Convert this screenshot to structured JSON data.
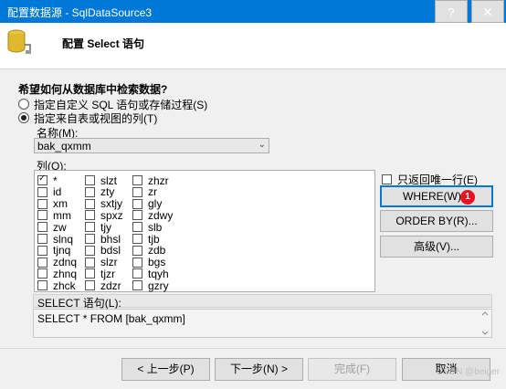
{
  "window": {
    "title": "配置数据源 - SqlDataSource3",
    "help_label": "?",
    "close_label": "✕"
  },
  "header": {
    "heading": "配置 Select 语句",
    "icon": "database-icon"
  },
  "prompt": "希望如何从数据库中检索数据?",
  "options": {
    "custom_sql": "指定自定义 SQL 语句或存储过程(S)",
    "table_cols": "指定来自表或视图的列(T)"
  },
  "name_label": "名称(M):",
  "table_select": {
    "value": "bak_qxmm"
  },
  "columns_label": "列(O):",
  "columns": {
    "c1": [
      {
        "name": "*",
        "checked": true
      },
      {
        "name": "id",
        "checked": false
      },
      {
        "name": "xm",
        "checked": false
      },
      {
        "name": "mm",
        "checked": false
      },
      {
        "name": "zw",
        "checked": false
      },
      {
        "name": "slnq",
        "checked": false
      },
      {
        "name": "tjnq",
        "checked": false
      },
      {
        "name": "zdnq",
        "checked": false
      },
      {
        "name": "zhnq",
        "checked": false
      },
      {
        "name": "zhck",
        "checked": false
      }
    ],
    "c2": [
      {
        "name": "slzt",
        "checked": false
      },
      {
        "name": "zty",
        "checked": false
      },
      {
        "name": "sxtjy",
        "checked": false
      },
      {
        "name": "spxz",
        "checked": false
      },
      {
        "name": "tjy",
        "checked": false
      },
      {
        "name": "bhsl",
        "checked": false
      },
      {
        "name": "bdsl",
        "checked": false
      },
      {
        "name": "slzr",
        "checked": false
      },
      {
        "name": "tjzr",
        "checked": false
      },
      {
        "name": "zdzr",
        "checked": false
      }
    ],
    "c3": [
      {
        "name": "zhzr",
        "checked": false
      },
      {
        "name": "zr",
        "checked": false
      },
      {
        "name": "gly",
        "checked": false
      },
      {
        "name": "zdwy",
        "checked": false
      },
      {
        "name": "slb",
        "checked": false
      },
      {
        "name": "tjb",
        "checked": false
      },
      {
        "name": "zdb",
        "checked": false
      },
      {
        "name": "bgs",
        "checked": false
      },
      {
        "name": "tqyh",
        "checked": false
      },
      {
        "name": "gzry",
        "checked": false
      }
    ]
  },
  "unique_rows_label": "只返回唯一行(E)",
  "buttons": {
    "where": "WHERE(W)...",
    "order_by": "ORDER BY(R)...",
    "advanced": "高级(V)...",
    "prev": "< 上一步(P)",
    "next": "下一步(N) >",
    "finish": "完成(F)",
    "cancel": "取消"
  },
  "badge": "1",
  "sql": {
    "label": "SELECT 语句(L):",
    "text": "SELECT * FROM [bak_qxmm]"
  },
  "watermark": "CSDN @beiger",
  "colors": {
    "titlebar": "#0078d7",
    "badge": "#e81123"
  }
}
